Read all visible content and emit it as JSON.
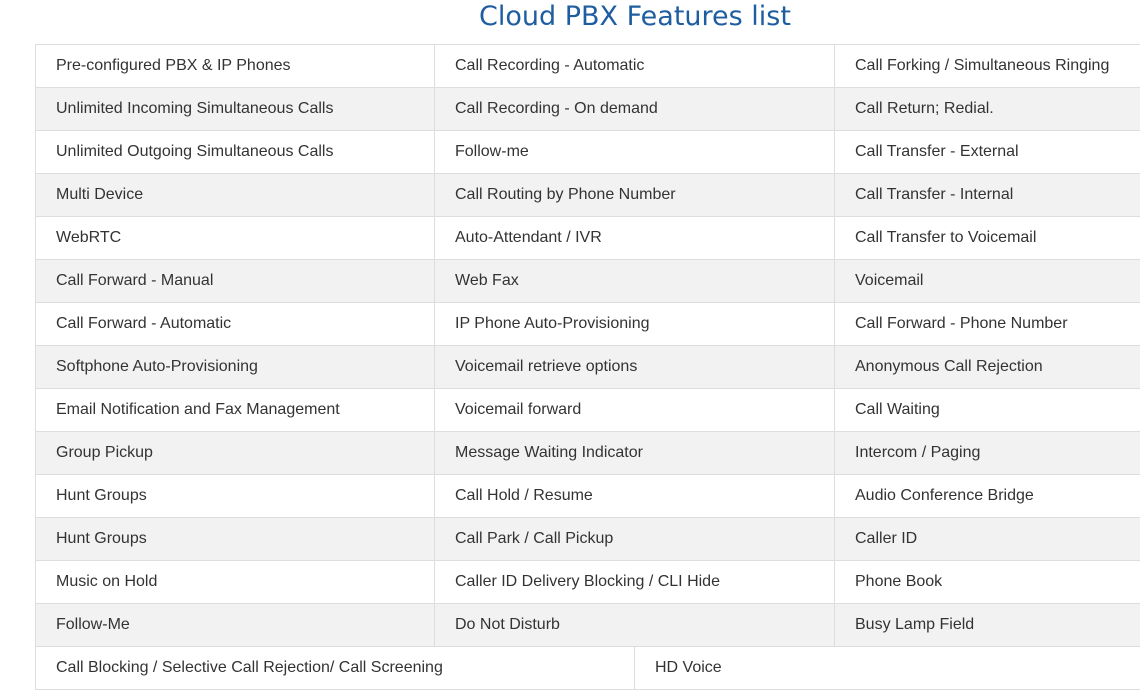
{
  "title": "Cloud PBX Features list",
  "colors": {
    "title": "#1f5da1",
    "text": "#333333",
    "border": "#dddddd",
    "stripe": "#f2f2f2"
  },
  "rows": [
    [
      "Pre-configured PBX & IP Phones",
      "Call Recording - Automatic",
      "Call Forking / Simultaneous Ringing"
    ],
    [
      "Unlimited Incoming Simultaneous Calls",
      "Call Recording - On demand",
      "Call Return; Redial."
    ],
    [
      "Unlimited Outgoing Simultaneous Calls",
      "Follow-me",
      "Call Transfer - External"
    ],
    [
      "Multi Device",
      "Call Routing by Phone Number",
      "Call Transfer - Internal"
    ],
    [
      "WebRTC",
      "Auto-Attendant / IVR",
      "Call Transfer to Voicemail"
    ],
    [
      "Call Forward - Manual",
      "Web Fax",
      "Voicemail"
    ],
    [
      "Call Forward - Automatic",
      "IP Phone Auto-Provisioning",
      "Call Forward - Phone Number"
    ],
    [
      "Softphone Auto-Provisioning",
      "Voicemail retrieve options",
      "Anonymous Call Rejection"
    ],
    [
      "Email Notification and Fax Management",
      "Voicemail forward",
      "Call Waiting"
    ],
    [
      "Group Pickup",
      "Message Waiting Indicator",
      "Intercom / Paging"
    ],
    [
      "Hunt Groups",
      "Call Hold / Resume",
      "Audio Conference Bridge"
    ],
    [
      "Hunt Groups",
      "Call Park / Call Pickup",
      "Caller ID"
    ],
    [
      "Music on Hold",
      "Caller ID Delivery Blocking / CLI Hide",
      "Phone Book"
    ],
    [
      "Follow-Me",
      "Do Not Disturb",
      "Busy Lamp Field"
    ]
  ],
  "last_row": [
    "Call Blocking / Selective Call Rejection/ Call Screening",
    "HD Voice"
  ]
}
